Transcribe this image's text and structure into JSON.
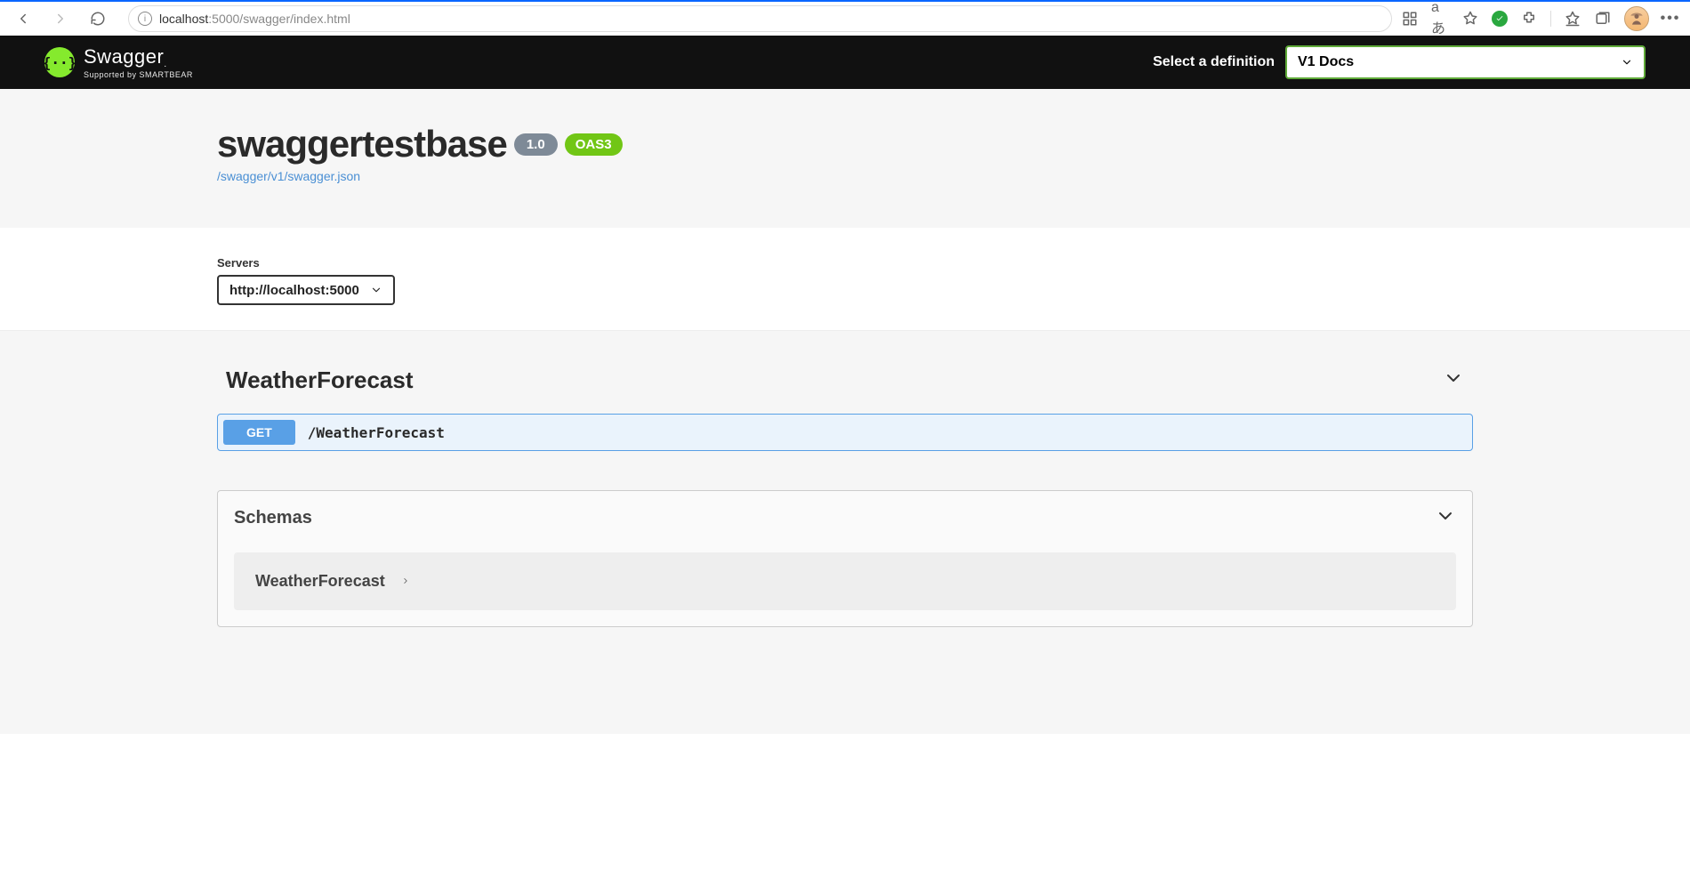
{
  "browser": {
    "url_host": "localhost",
    "url_rest": ":5000/swagger/index.html"
  },
  "topbar": {
    "logo_label": "Swagger",
    "logo_sub": "Supported by SMARTBEAR",
    "definition_label": "Select a definition",
    "definition_selected": "V1 Docs"
  },
  "info": {
    "title": "swaggertestbase",
    "version_badge": "1.0",
    "oas_badge": "OAS3",
    "spec_link": "/swagger/v1/swagger.json"
  },
  "servers": {
    "label": "Servers",
    "selected": "http://localhost:5000"
  },
  "tag": {
    "name": "WeatherForecast",
    "operations": [
      {
        "method": "GET",
        "path": "/WeatherForecast"
      }
    ]
  },
  "schemas": {
    "heading": "Schemas",
    "items": [
      "WeatherForecast"
    ]
  }
}
